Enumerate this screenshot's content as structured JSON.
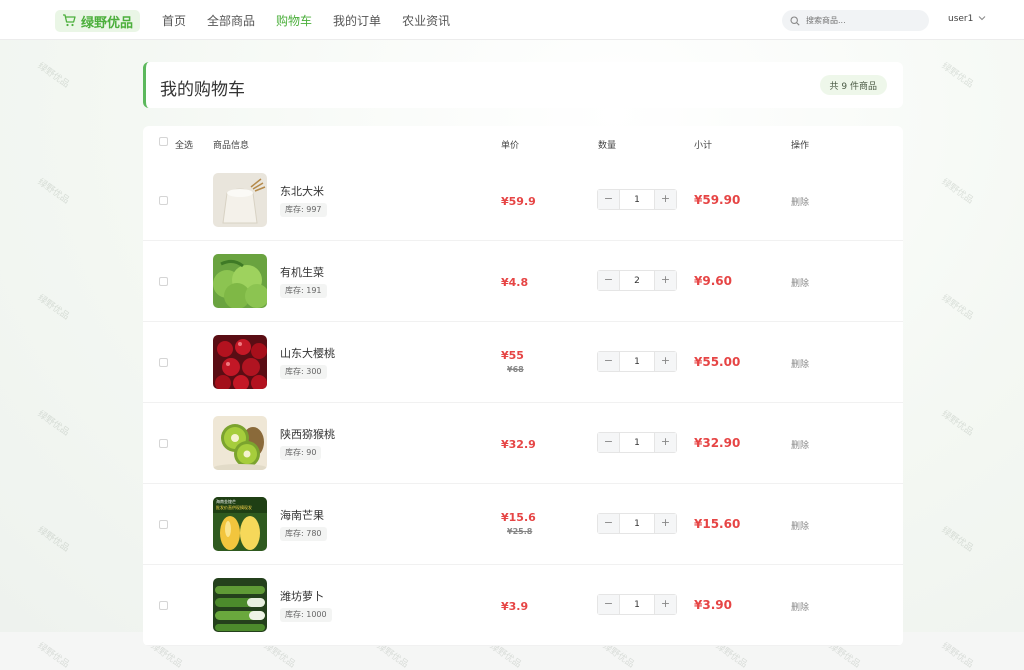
{
  "header": {
    "logo_text": "绿野优品",
    "nav": [
      {
        "label": "首页",
        "active": false
      },
      {
        "label": "全部商品",
        "active": false
      },
      {
        "label": "购物车",
        "active": true
      },
      {
        "label": "我的订单",
        "active": false
      },
      {
        "label": "农业资讯",
        "active": false
      }
    ],
    "search_placeholder": "搜索商品...",
    "username": "user1"
  },
  "page": {
    "title": "我的购物车",
    "count_badge": "共 9 件商品"
  },
  "table": {
    "headers": {
      "select_all": "全选",
      "product": "商品信息",
      "unit_price": "单价",
      "quantity": "数量",
      "subtotal": "小计",
      "actions": "操作"
    },
    "delete_label": "删除",
    "stepper_minus": "−",
    "stepper_plus": "+"
  },
  "items": [
    {
      "name": "东北大米",
      "stock": "库存: 997",
      "price": "¥59.9",
      "old_price": null,
      "qty": "1",
      "subtotal": "¥59.90"
    },
    {
      "name": "有机生菜",
      "stock": "库存: 191",
      "price": "¥4.8",
      "old_price": null,
      "qty": "2",
      "subtotal": "¥9.60"
    },
    {
      "name": "山东大樱桃",
      "stock": "库存: 300",
      "price": "¥55",
      "old_price": "¥68",
      "qty": "1",
      "subtotal": "¥55.00"
    },
    {
      "name": "陕西猕猴桃",
      "stock": "库存: 90",
      "price": "¥32.9",
      "old_price": null,
      "qty": "1",
      "subtotal": "¥32.90"
    },
    {
      "name": "海南芒果",
      "stock": "库存: 780",
      "price": "¥15.6",
      "old_price": "¥25.8",
      "qty": "1",
      "subtotal": "¥15.60"
    },
    {
      "name": "潍坊萝卜",
      "stock": "库存: 1000",
      "price": "¥3.9",
      "old_price": null,
      "qty": "1",
      "subtotal": "¥3.90"
    }
  ],
  "mango_label_line1": "海南金煌芒",
  "mango_label_line2": "批发价直供现摘现发",
  "watermark_text": "绿野优品",
  "colors": {
    "brand": "#4caf3c",
    "price": "#e64545"
  }
}
